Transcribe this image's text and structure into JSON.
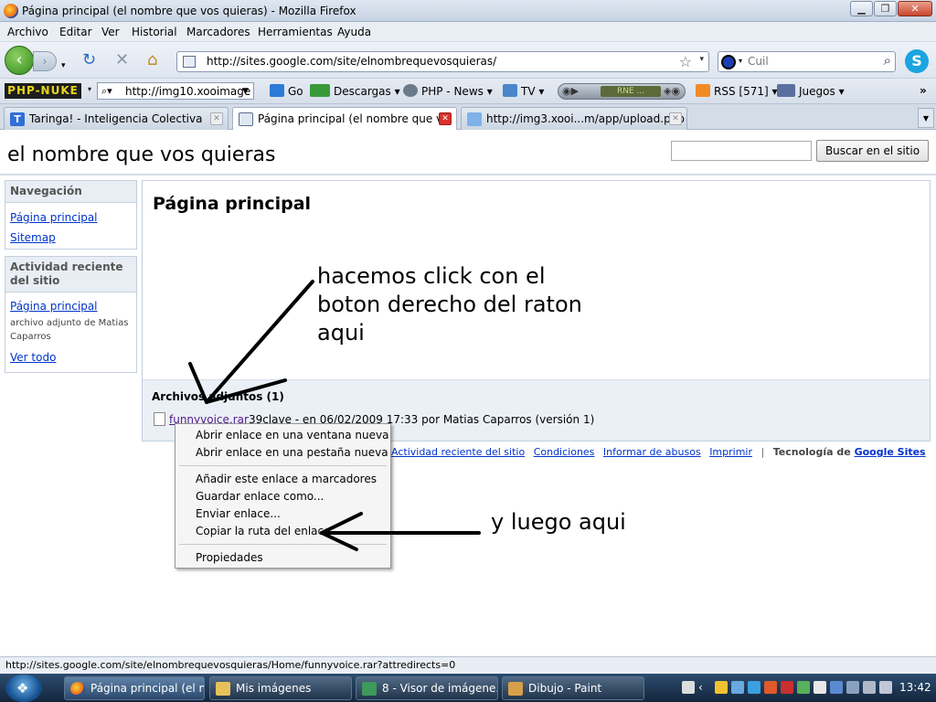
{
  "window": {
    "title": "Página principal (el nombre que vos quieras) - Mozilla Firefox",
    "minimize": "▁",
    "maximize": "❐",
    "close": "✕"
  },
  "menu": [
    "Archivo",
    "Editar",
    "Ver",
    "Historial",
    "Marcadores",
    "Herramientas",
    "Ayuda"
  ],
  "nav": {
    "url": "http://sites.google.com/site/elnombrequevosquieras/",
    "search_placeholder": "Cuil"
  },
  "bookmarks": {
    "logo": "PHP-NUKE",
    "search_value": "http://img10.xooimage",
    "items": [
      "Go",
      "Descargas",
      "PHP - News",
      "TV",
      "RSS [571]",
      "Juegos"
    ],
    "radio_station": "RNE ...",
    "more": "»"
  },
  "tabs": [
    {
      "label": "Taringa! - Inteligencia Colectiva"
    },
    {
      "label": "Página principal (el nombre que v..."
    },
    {
      "label": "http://img3.xooi...m/app/upload.php"
    }
  ],
  "site": {
    "title": "el nombre que vos quieras",
    "search_button": "Buscar en el sitio",
    "nav_title": "Navegación",
    "nav_links": [
      "Página principal",
      "Sitemap"
    ],
    "activity_title": "Actividad reciente del sitio",
    "activity_link": "Página principal",
    "activity_desc": "archivo adjunto de Matias Caparros",
    "view_all": "Ver todo",
    "page_title": "Página principal",
    "attachments_title": "Archivos adjuntos (1)",
    "file_name": "funnyvoice.rar",
    "file_meta": "39clave - en 06/02/2009 17:33 por Matias Caparros (versión 1)",
    "footer_links": [
      "Actividad reciente del sitio",
      "Condiciones",
      "Informar de abusos",
      "Imprimir"
    ],
    "footer_sep": "|",
    "footer_tech": "Tecnología de",
    "footer_brand": "Google Sites"
  },
  "context_menu": [
    "Abrir enlace en una ventana nueva",
    "Abrir enlace en una pestaña nueva",
    "Añadir este enlace a marcadores",
    "Guardar enlace como...",
    "Enviar enlace...",
    "Copiar la ruta del enlace",
    "Propiedades"
  ],
  "annotations": {
    "first": [
      "hacemos click con el",
      "boton derecho del raton",
      "aqui"
    ],
    "second": "y luego aqui"
  },
  "status": "http://sites.google.com/site/elnombrequevosquieras/Home/funnyvoice.rar?attredirects=0",
  "taskbar": {
    "items": [
      "Página principal (el n...",
      "Mis imágenes",
      "8 - Visor de imágene...",
      "Dibujo - Paint"
    ],
    "clock": "13:42"
  }
}
